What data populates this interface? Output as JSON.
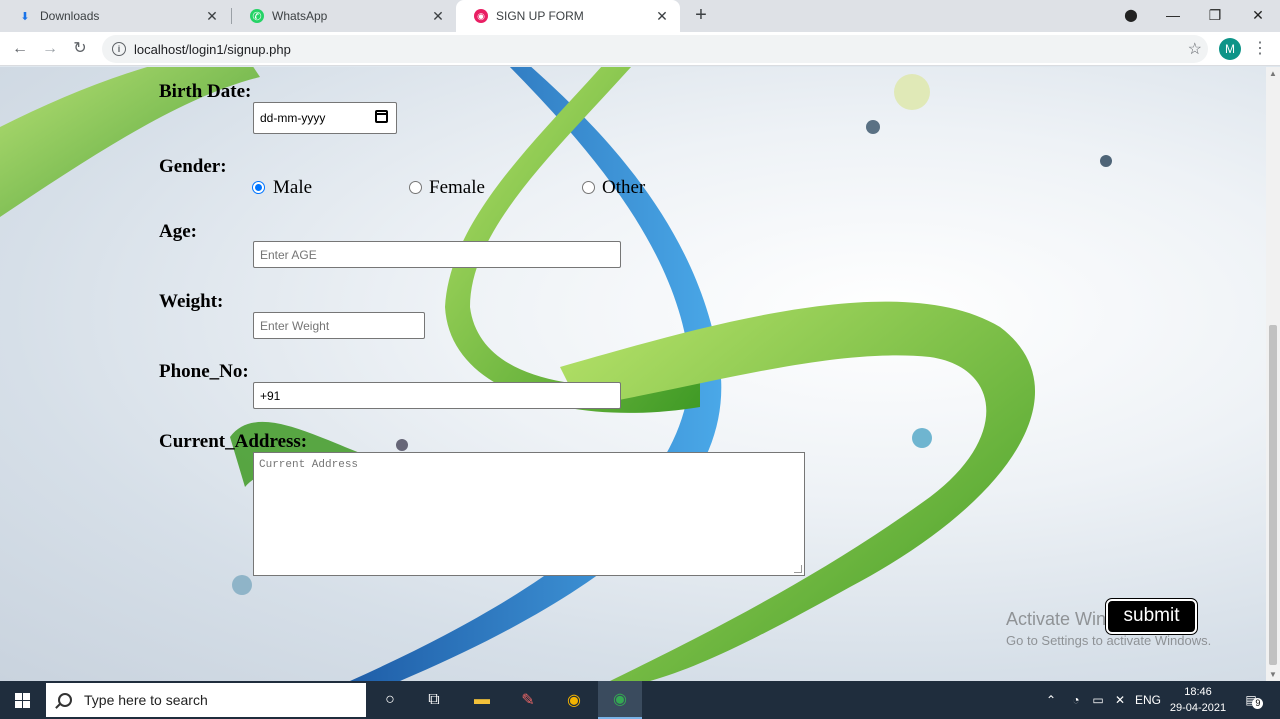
{
  "browser": {
    "tabs": [
      {
        "label": "Downloads",
        "icon": "download-icon",
        "active": false
      },
      {
        "label": "WhatsApp",
        "icon": "whatsapp-icon",
        "active": false
      },
      {
        "label": "SIGN UP FORM",
        "icon": "site-icon",
        "active": true
      }
    ],
    "new_tab": "+",
    "url": "localhost/login1/signup.php",
    "profile_initial": "M"
  },
  "form": {
    "birth_label": "Birth Date:",
    "birth_value": "dd-mm-yyyy",
    "gender_label": "Gender:",
    "gender_options": [
      "Male",
      "Female",
      "Other"
    ],
    "gender_selected": "Male",
    "age_label": "Age:",
    "age_placeholder": "Enter AGE",
    "weight_label": "Weight:",
    "weight_placeholder": "Enter Weight",
    "phone_label": "Phone_No:",
    "phone_value": "+91",
    "address_label": "Current_Address:",
    "address_placeholder": "Current Address",
    "submit_label": "submit"
  },
  "watermark": {
    "line1": "Activate Windows",
    "line2": "Go to Settings to activate Windows."
  },
  "taskbar": {
    "search_placeholder": "Type here to search",
    "language": "ENG",
    "time": "18:46",
    "date": "29-04-2021",
    "notification_count": "9"
  },
  "colors": {
    "accent_radio": "#0075ff",
    "profile": "#0d9488",
    "taskbar": "#1f2d3d"
  }
}
